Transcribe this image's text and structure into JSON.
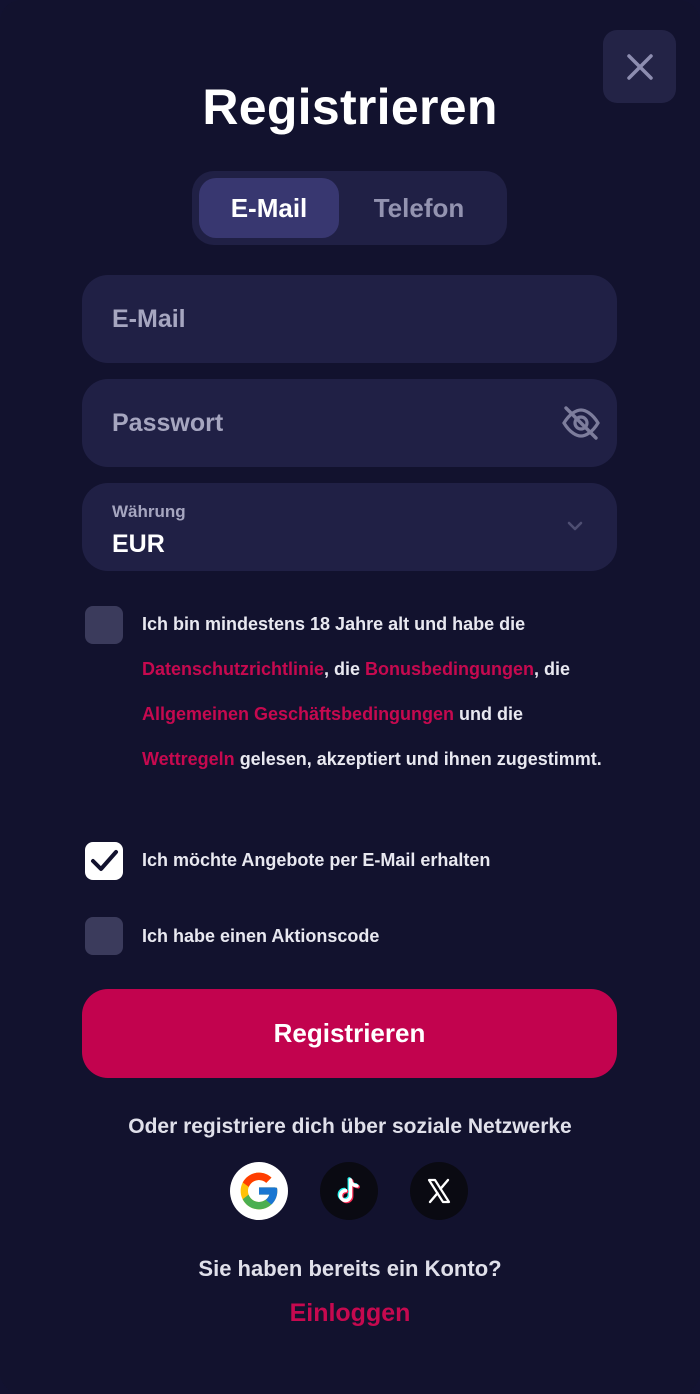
{
  "dialog": {
    "title": "Registrieren",
    "close_icon": "close-icon"
  },
  "tabs": [
    {
      "label": "E-Mail",
      "active": true
    },
    {
      "label": "Telefon",
      "active": false
    }
  ],
  "form": {
    "email": {
      "placeholder": "E-Mail",
      "value": ""
    },
    "password": {
      "placeholder": "Passwort",
      "value": "",
      "icon": "eye-off-icon"
    },
    "currency": {
      "label": "Währung",
      "value": "EUR",
      "icon": "chevron-down-icon"
    }
  },
  "terms": {
    "checked": false,
    "text_1": "Ich bin mindestens 18 Jahre alt und habe die ",
    "link_privacy": "Datenschutzrichtlinie",
    "text_2": ", die ",
    "link_bonus": "Bonusbedingungen",
    "text_3": ", die ",
    "link_gtc": "Allgemeinen Geschäftsbedingungen",
    "text_4": " und die ",
    "link_betting": "Wettregeln",
    "text_5": " gelesen, akzeptiert und ihnen zugestimmt."
  },
  "offers": {
    "checked": true,
    "label": "Ich möchte Angebote per E-Mail erhalten"
  },
  "promo": {
    "checked": false,
    "label": "Ich habe einen Aktionscode"
  },
  "submit_label": "Registrieren",
  "social": {
    "label": "Oder registriere dich über soziale Netzwerke",
    "providers": [
      "google-icon",
      "tiktok-icon",
      "x-icon"
    ]
  },
  "footer": {
    "question": "Sie haben bereits ein Konto?",
    "login_label": "Einloggen"
  },
  "colors": {
    "background": "#12122e",
    "field": "#202045",
    "accent": "#c2034e",
    "link": "#c6094f"
  }
}
